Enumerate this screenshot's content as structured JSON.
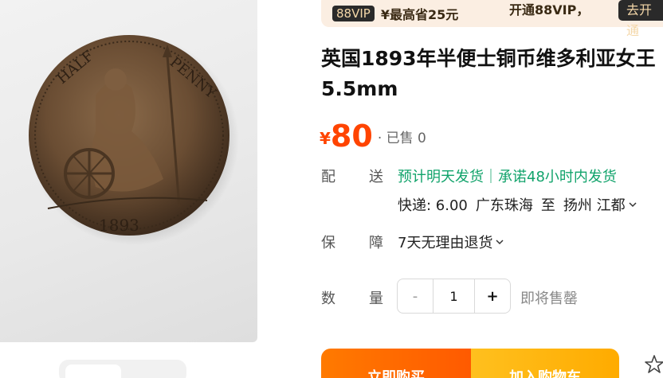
{
  "vip": {
    "badge": "88VIP",
    "save_text": "¥最高省25元",
    "open_text": "开通88VIP，",
    "button": "去开通"
  },
  "product": {
    "title_line1": "英国1893年半便士铜币维多利亚女王",
    "title_line2": "5.5mm",
    "currency": "¥",
    "price": "80",
    "sold": "· 已售 0",
    "coin_year": "1893",
    "coin_legend": "HALF PENNY"
  },
  "shipping": {
    "label_a": "配",
    "label_b": "送",
    "promise": "预计明天发货｜承诺48小时内发货",
    "express": "快递: 6.00",
    "from": "广东珠海",
    "to_word": "至",
    "to": "扬州 江都"
  },
  "guarantee": {
    "label_a": "保",
    "label_b": "障",
    "text": "7天无理由退货"
  },
  "quantity": {
    "label_a": "数",
    "label_b": "量",
    "minus": "-",
    "value": "1",
    "plus": "+",
    "stock_note": "即将售罄"
  },
  "actions": {
    "buy": "立即购买",
    "cart": "加入购物车"
  },
  "colors": {
    "price": "#ff4400",
    "promise": "#11a36b",
    "buy_button": "#ff6a00",
    "cart_button": "#ffb400"
  },
  "icons": [
    "chevron-down-icon",
    "star-icon"
  ]
}
